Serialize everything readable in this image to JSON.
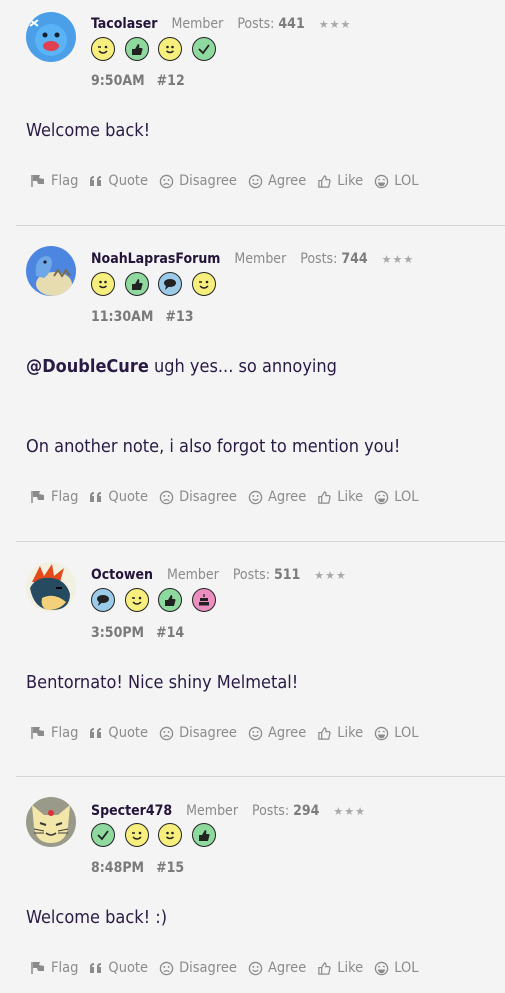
{
  "actions": {
    "flag": "Flag",
    "quote": "Quote",
    "disagree": "Disagree",
    "agree": "Agree",
    "like": "Like",
    "lol": "LOL"
  },
  "posts": [
    {
      "username": "Tacolaser",
      "role": "Member",
      "posts_label": "Posts:",
      "post_count": "441",
      "stars": "★★★",
      "time": "9:50AM",
      "number": "#12",
      "body": [
        "Welcome back!"
      ],
      "badges": [
        "wink-icon",
        "thumbs-up-icon",
        "smile-icon",
        "check-icon"
      ]
    },
    {
      "username": "NoahLaprasForum",
      "role": "Member",
      "posts_label": "Posts:",
      "post_count": "744",
      "stars": "★★★",
      "time": "11:30AM",
      "number": "#13",
      "mention": "@DoubleCure",
      "body": [
        " ugh yes... so annoying",
        "On another note, i also forgot to mention you!"
      ],
      "badges": [
        "smile-icon",
        "thumbs-up-icon",
        "speech-bubble-icon",
        "wink-icon"
      ]
    },
    {
      "username": "Octowen",
      "role": "Member",
      "posts_label": "Posts:",
      "post_count": "511",
      "stars": "★★★",
      "time": "3:50PM",
      "number": "#14",
      "body": [
        "Bentornato! Nice shiny Melmetal!"
      ],
      "badges": [
        "speech-bubble-icon",
        "wink-icon",
        "thumbs-up-icon",
        "cake-icon"
      ]
    },
    {
      "username": "Specter478",
      "role": "Member",
      "posts_label": "Posts:",
      "post_count": "294",
      "stars": "★★★",
      "time": "8:48PM",
      "number": "#15",
      "body": [
        "Welcome back! :)"
      ],
      "badges": [
        "check-icon",
        "wink-icon",
        "smile-icon",
        "thumbs-up-icon"
      ]
    }
  ],
  "colors": {
    "yellow_badge": "#f7ef7d",
    "green_badge": "#8ed99e",
    "blue_badge": "#9ccbea",
    "pink_badge": "#ea8fc0",
    "username": "#24143a",
    "body_text": "#2a1b45",
    "muted": "#8a8a8a"
  }
}
